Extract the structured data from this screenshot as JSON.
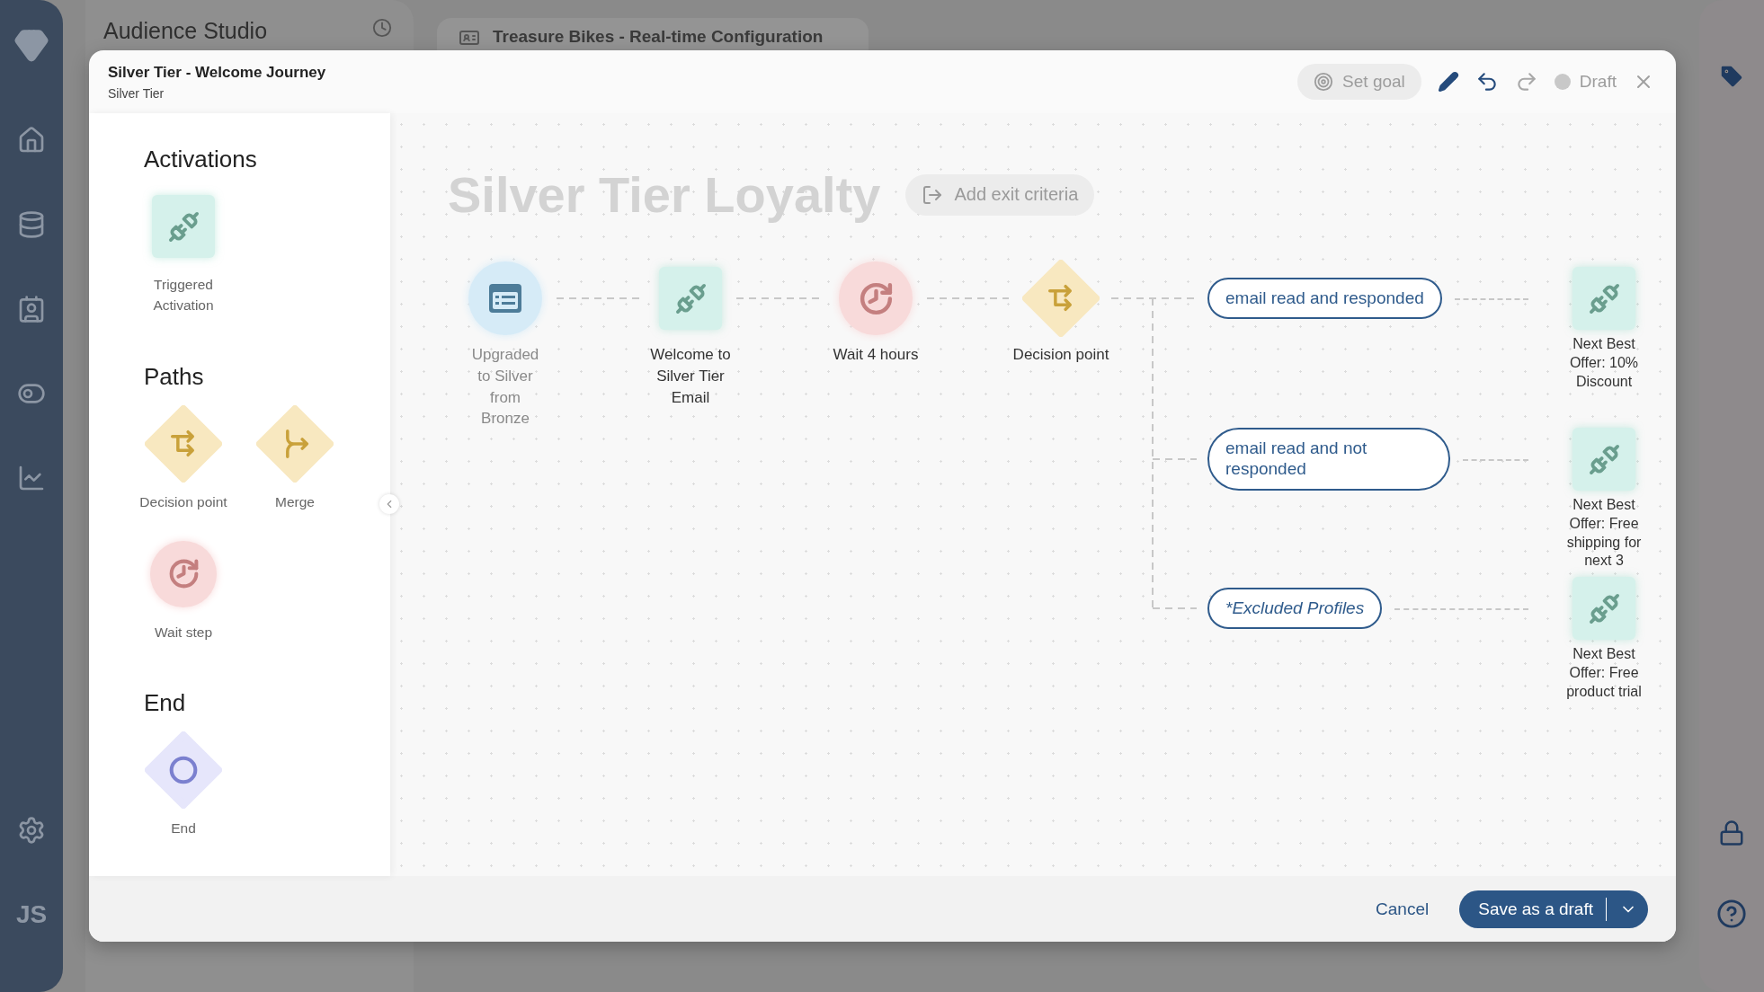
{
  "nav": {
    "user_initials": "JS"
  },
  "background": {
    "app_title": "Audience Studio",
    "tab_title": "Treasure Bikes - Real-time Configuration"
  },
  "modal": {
    "title": "Silver Tier - Welcome Journey",
    "subtitle": "Silver Tier",
    "set_goal": "Set goal",
    "status": "Draft",
    "history": [
      {
        "kind": "undo",
        "disabled": false
      },
      {
        "kind": "redo",
        "disabled": true
      }
    ]
  },
  "palette": {
    "sections": [
      {
        "heading": "Activations",
        "items": [
          {
            "kind": "activation",
            "label": "Triggered Activation"
          }
        ]
      },
      {
        "heading": "Paths",
        "items": [
          {
            "kind": "decision",
            "label": "Decision point"
          },
          {
            "kind": "merge",
            "label": "Merge"
          },
          {
            "kind": "wait",
            "label": "Wait step"
          }
        ]
      },
      {
        "heading": "End",
        "items": [
          {
            "kind": "end",
            "label": "End"
          }
        ]
      }
    ]
  },
  "canvas": {
    "journey_title": "Silver Tier Loyalty",
    "exit_criteria": "Add exit criteria",
    "steps": [
      {
        "kind": "audience",
        "label": "Upgraded to Silver from Bronze",
        "disabled": true
      },
      {
        "kind": "activation",
        "label": "Welcome to Silver Tier Email",
        "disabled": false
      },
      {
        "kind": "wait",
        "label": "Wait 4 hours",
        "disabled": false
      },
      {
        "kind": "decision",
        "label": "Decision point",
        "disabled": false
      }
    ],
    "branches": [
      {
        "kind": "condition",
        "label": "email read and responded",
        "target": {
          "kind": "activation",
          "label": "Next Best Offer: 10% Discount"
        }
      },
      {
        "kind": "condition",
        "label": "email read and not responded",
        "target": {
          "kind": "activation",
          "label": "Next Best Offer: Free shipping for next 3"
        }
      },
      {
        "kind": "excluded",
        "label": "*Excluded Profiles",
        "target": {
          "kind": "activation",
          "label": "Next Best Offer: Free product trial"
        }
      }
    ]
  },
  "footer": {
    "cancel": "Cancel",
    "save": "Save as a draft"
  }
}
